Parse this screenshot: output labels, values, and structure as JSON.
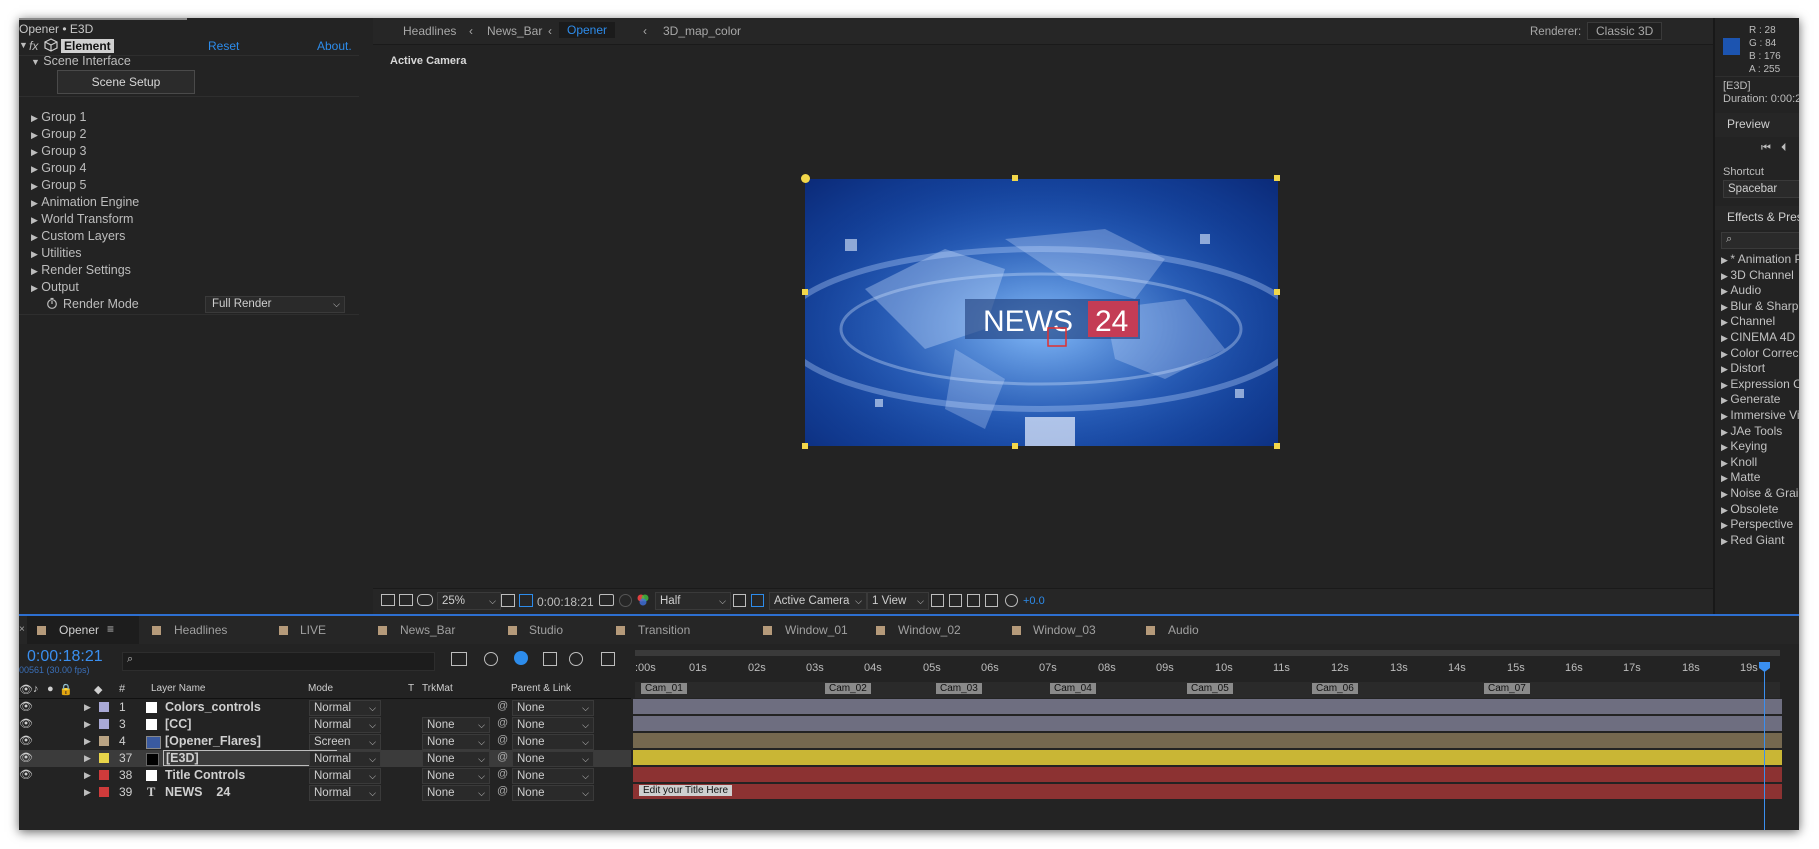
{
  "effect_controls": {
    "title": "Opener • E3D",
    "fx_label": "fx",
    "effect_name": "Element",
    "reset": "Reset",
    "about": "About.",
    "scene_interface": "Scene Interface",
    "scene_setup": "Scene Setup",
    "groups": [
      "Group 1",
      "Group 2",
      "Group 3",
      "Group 4",
      "Group 5",
      "Animation Engine",
      "World Transform",
      "Custom Layers",
      "Utilities",
      "Render Settings",
      "Output"
    ],
    "render_mode_label": "Render Mode",
    "render_mode_value": "Full Render"
  },
  "viewer": {
    "breadcrumbs": [
      "Headlines",
      "News_Bar",
      "Opener",
      "3D_map_color"
    ],
    "renderer_label": "Renderer:",
    "renderer_value": "Classic 3D",
    "active_camera": "Active Camera",
    "toolbar": {
      "zoom": "25%",
      "timecode": "0:00:18:21",
      "resolution": "Half",
      "camera": "Active Camera",
      "views": "1 View",
      "exposure": "+0.0"
    },
    "frame_text": {
      "news": "NEWS",
      "num": "24"
    }
  },
  "right_panel": {
    "color": {
      "r": "R : 28",
      "g": "G : 84",
      "b": "B : 176",
      "a": "A : 255",
      "swatch": "#1c54b0"
    },
    "info": "[E3D]",
    "duration": "Duration: 0:00:2",
    "preview": "Preview",
    "shortcut_label": "Shortcut",
    "shortcut_value": "Spacebar",
    "effects_title": "Effects & Prese",
    "effects": [
      "* Animation P",
      "3D Channel",
      "Audio",
      "Blur & Sharpe",
      "Channel",
      "CINEMA 4D",
      "Color Correc",
      "Distort",
      "Expression C",
      "Generate",
      "Immersive Vi",
      "JAe Tools",
      "Keying",
      "Knoll",
      "Matte",
      "Noise & Grai",
      "Obsolete",
      "Perspective",
      "Red Giant"
    ]
  },
  "timeline_tabs": [
    {
      "label": "Opener",
      "color": "#b59a7a"
    },
    {
      "label": "Headlines",
      "color": "#b59a7a"
    },
    {
      "label": "LIVE",
      "color": "#b59a7a"
    },
    {
      "label": "News_Bar",
      "color": "#b59a7a"
    },
    {
      "label": "Studio",
      "color": "#b59a7a"
    },
    {
      "label": "Transition",
      "color": "#b59a7a"
    },
    {
      "label": "Window_01",
      "color": "#b59a7a"
    },
    {
      "label": "Window_02",
      "color": "#b59a7a"
    },
    {
      "label": "Window_03",
      "color": "#b59a7a"
    },
    {
      "label": "Audio",
      "color": "#b59a7a"
    }
  ],
  "layer_panel": {
    "timecode": "0:00:18:21",
    "fps": "00561 (30.00 fps)",
    "headers": {
      "num": "#",
      "name": "Layer Name",
      "mode": "Mode",
      "t": "T",
      "trkmat": "TrkMat",
      "parent": "Parent & Link"
    },
    "layers": [
      {
        "num": "1",
        "name": "Colors_controls",
        "mode": "Normal",
        "trkmat": "",
        "parent": "None",
        "label": "#a9a9d6",
        "swatch": "#ffffff",
        "bar": "#6e6e80"
      },
      {
        "num": "3",
        "name": "[CC]",
        "mode": "Normal",
        "trkmat": "None",
        "parent": "None",
        "label": "#a9a9d6",
        "swatch": "#ffffff",
        "bar": "#6e6e80"
      },
      {
        "num": "4",
        "name": "[Opener_Flares]",
        "mode": "Screen",
        "trkmat": "None",
        "parent": "None",
        "label": "#b9a383",
        "swatch": "#3a5aa0",
        "bar": "#75684f"
      },
      {
        "num": "37",
        "name": "[E3D]",
        "mode": "Normal",
        "trkmat": "None",
        "parent": "None",
        "label": "#e8d54a",
        "swatch": "#000000",
        "bar": "#c9b635"
      },
      {
        "num": "38",
        "name": "Title Controls",
        "mode": "Normal",
        "trkmat": "None",
        "parent": "None",
        "label": "#cf3b3b",
        "swatch": "#ffffff",
        "bar": "#8c3232"
      },
      {
        "num": "39",
        "name": "NEWS    24",
        "mode": "Normal",
        "trkmat": "None",
        "parent": "None",
        "label": "#cf3b3b",
        "swatch": "T",
        "bar": "#8c3232"
      }
    ]
  },
  "timeline": {
    "ticks": [
      ":00s",
      "01s",
      "02s",
      "03s",
      "04s",
      "05s",
      "06s",
      "07s",
      "08s",
      "09s",
      "10s",
      "11s",
      "12s",
      "13s",
      "14s",
      "15s",
      "16s",
      "17s",
      "18s",
      "19s"
    ],
    "markers": [
      "Cam_01",
      "Cam_02",
      "Cam_03",
      "Cam_04",
      "Cam_05",
      "Cam_06",
      "Cam_07"
    ],
    "title_marker": "Edit your Title Here"
  }
}
